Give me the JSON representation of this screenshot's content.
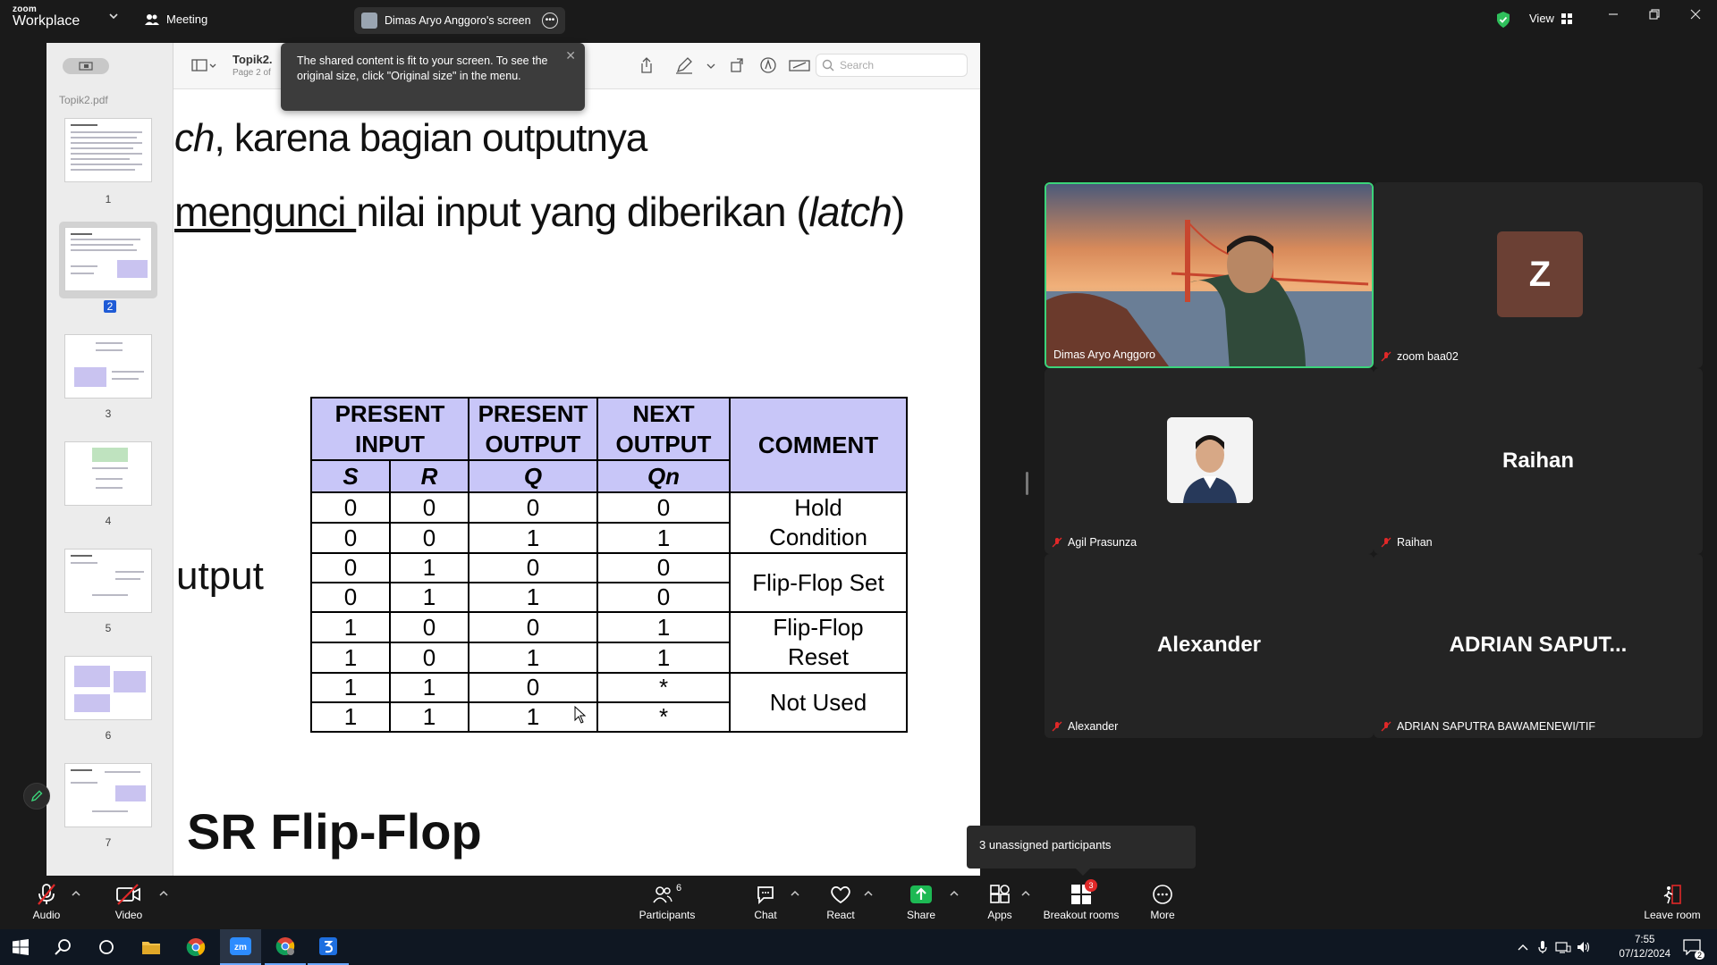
{
  "app": {
    "logo_line1": "zoom",
    "logo_line2": "Workplace"
  },
  "titlebar": {
    "meeting_label": "Meeting",
    "screen_share_label": "Dimas Aryo Anggoro's screen",
    "view_label": "View"
  },
  "pdf": {
    "file_name": "Topik2.pdf",
    "doc_title": "Topik2.",
    "doc_sub": "Page 2 of",
    "search_placeholder": "Search",
    "thumb_numbers": [
      "1",
      "2",
      "3",
      "4",
      "5",
      "6",
      "7"
    ],
    "selected_page": "2"
  },
  "tooltip": {
    "text": "The shared content is fit to your screen. To see the original size, click \"Original size\" in the menu."
  },
  "page": {
    "line1_italic": "ch",
    "line1_rest": ", karena bagian outputnya",
    "line2_underlined": "mengunci ",
    "line2_rest": "nilai input yang diberikan (",
    "line2_italic": "latch",
    "line2_end": ")",
    "output_text": "utput",
    "heading": "SR Flip-Flop"
  },
  "table": {
    "headers": [
      "PRESENT INPUT",
      "PRESENT OUTPUT",
      "NEXT OUTPUT",
      "COMMENT"
    ],
    "subheaders": [
      "S",
      "R",
      "Q",
      "Qn"
    ],
    "rows": [
      [
        "0",
        "0",
        "0",
        "0"
      ],
      [
        "0",
        "0",
        "1",
        "1"
      ],
      [
        "0",
        "1",
        "0",
        "0"
      ],
      [
        "0",
        "1",
        "1",
        "0"
      ],
      [
        "1",
        "0",
        "0",
        "1"
      ],
      [
        "1",
        "0",
        "1",
        "1"
      ],
      [
        "1",
        "1",
        "0",
        "*"
      ],
      [
        "1",
        "1",
        "1",
        "*"
      ]
    ],
    "comments": [
      "Hold Condition",
      "Flip-Flop Set",
      "Flip-Flop Reset",
      "Not Used"
    ]
  },
  "participants": {
    "dimas": "Dimas Aryo Anggoro",
    "zoom": "zoom baa02",
    "z_initial": "Z",
    "agil": "Agil Prasunza",
    "raihan_big": "Raihan",
    "raihan": "Raihan",
    "alexander_big": "Alexander",
    "alexander": "Alexander",
    "adrian_big": "ADRIAN  SAPUT...",
    "adrian": "ADRIAN SAPUTRA BAWAMENEWI/TIF"
  },
  "unassigned": "3 unassigned participants",
  "controls": {
    "audio": "Audio",
    "video": "Video",
    "participants": "Participants",
    "participants_count": "6",
    "chat": "Chat",
    "react": "React",
    "share": "Share",
    "apps": "Apps",
    "breakout": "Breakout rooms",
    "breakout_badge": "3",
    "more": "More",
    "leave": "Leave room"
  },
  "taskbar": {
    "time": "7:55",
    "date": "07/12/2024",
    "notif_count": "2"
  },
  "colors": {
    "active_border": "#3bd47a",
    "share_green": "#1db954",
    "table_header": "#c8c6f8",
    "badge_red": "#e02828"
  }
}
